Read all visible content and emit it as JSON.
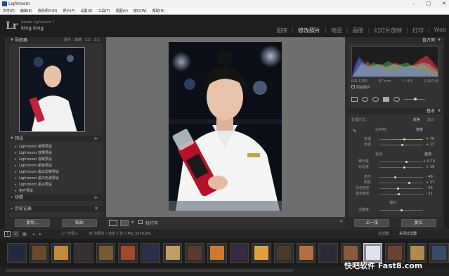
{
  "window": {
    "title": "Lightroom",
    "controls": [
      "–",
      "□",
      "✕"
    ]
  },
  "menu": [
    "文件(F)",
    "编辑(E)",
    "修改照片(D)",
    "照片(P)",
    "设置(S)",
    "工具(T)",
    "视图(V)",
    "窗口(W)",
    "帮助(H)"
  ],
  "identity": {
    "logo": "Lr",
    "version": "Adobe Lightroom 7",
    "user": "king king"
  },
  "modules": [
    {
      "label": "图库",
      "active": false
    },
    {
      "label": "修改照片",
      "active": true
    },
    {
      "label": "地图",
      "active": false
    },
    {
      "label": "画册",
      "active": false
    },
    {
      "label": "幻灯片放映",
      "active": false
    },
    {
      "label": "打印",
      "active": false
    },
    {
      "label": "Web",
      "active": false
    }
  ],
  "left": {
    "navigator": {
      "title": "导航器",
      "options": [
        "适合",
        "填满",
        "1:1",
        "3:1"
      ]
    },
    "presets": {
      "title": "预设",
      "items": [
        "Lightroom 常规预设",
        "Lightroom 效果预设",
        "Lightroom 视频预设",
        "Lightroom 颜色预设",
        "Lightroom 黑白滤镜预设",
        "Lightroom 黑白色调预设",
        "Lightroom 黑白预设",
        "用户预设"
      ]
    },
    "snapshots": {
      "title": "快照"
    },
    "history": {
      "title": "历史记录"
    },
    "buttons": {
      "copy": "复制...",
      "paste": "粘贴"
    }
  },
  "toolbar": {
    "softproof": "软打样"
  },
  "right": {
    "histogram": {
      "title": "直方图",
      "info": [
        "ISO 1250",
        "47 mm",
        "f / 4.5",
        "1/100 秒"
      ],
      "original": "原始照片"
    },
    "basic": {
      "title": "基本",
      "treatment_label": "处理方式：",
      "treatment": [
        "彩色",
        "黑白"
      ],
      "wb_label": "白平衡：",
      "wb_value": "自定",
      "temp": {
        "label": "色温",
        "value": "+ 70",
        "pos": 0.58
      },
      "tint": {
        "label": "色调",
        "value": "+ 13",
        "pos": 0.53
      },
      "tone_label": "色调",
      "auto": "自动",
      "exposure": {
        "label": "曝光度",
        "value": "+ 0.70",
        "pos": 0.62
      },
      "contrast": {
        "label": "对比度",
        "value": "+ 19",
        "pos": 0.58
      },
      "highlights": {
        "label": "高光",
        "value": "- 48",
        "pos": 0.36
      },
      "shadows": {
        "label": "阴影",
        "value": "+ 37",
        "pos": 0.68
      },
      "whites": {
        "label": "白色色阶",
        "value": "- 26",
        "pos": 0.42
      },
      "blacks": {
        "label": "黑色色阶",
        "value": "- 21",
        "pos": 0.44
      },
      "presence_label": "偏好",
      "clarity": {
        "label": "清晰度",
        "value": "",
        "pos": 0.5
      }
    },
    "buttons": {
      "previous": "上一张",
      "reset": "复位"
    }
  },
  "filmstrip": {
    "pages": [
      "1",
      "2"
    ],
    "source": "上一次导入",
    "count": "30 张照片 / 选定 1 张 / IMG_5276.JPG",
    "filter_label": "过滤器：",
    "filter_value": "关闭过滤器",
    "thumbs": 20,
    "selected_index": 16
  },
  "watermark": "快吧软件 Fast8.com"
}
